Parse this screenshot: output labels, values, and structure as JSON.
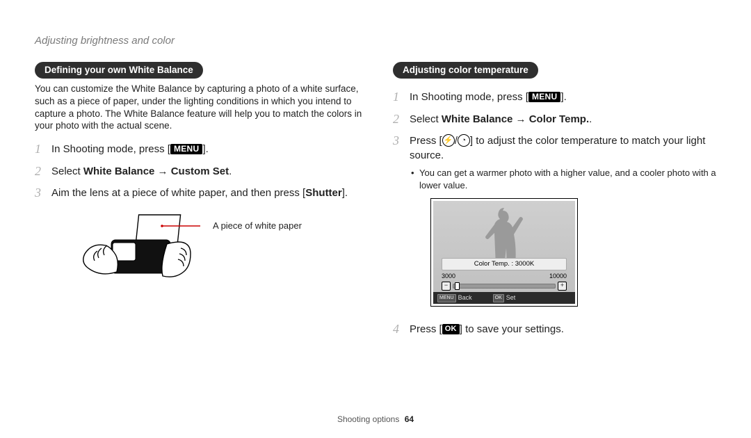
{
  "breadcrumb": "Adjusting brightness and color",
  "left": {
    "pill": "Defining your own White Balance",
    "intro": "You can customize the White Balance by capturing a photo of a white surface, such as a piece of paper, under the lighting conditions in which you intend to capture a photo. The White Balance feature will help you to match the colors in your photo with the actual scene.",
    "steps": {
      "s1_a": "In Shooting mode, press [",
      "menu": "MENU",
      "s1_b": "].",
      "s2_a": "Select ",
      "s2_bold": "White Balance → Custom Set",
      "s2_b": ".",
      "s3_a": "Aim the lens at a piece of white paper, and then press [",
      "s3_bold": "Shutter",
      "s3_b": "]."
    },
    "callout": "A piece of white paper"
  },
  "right": {
    "pill": "Adjusting color temperature",
    "steps": {
      "s1_a": "In Shooting mode, press [",
      "menu": "MENU",
      "s1_b": "].",
      "s2_a": "Select ",
      "s2_bold": "White Balance → Color Temp.",
      "s2_b": ".",
      "s3_a": "Press [",
      "s3_b": "/",
      "s3_c": "] to adjust the color temperature to match your light source.",
      "s3_sub": "You can get a warmer photo with a higher value, and a cooler photo with a lower value.",
      "s4_a": "Press [",
      "ok": "OK",
      "s4_b": "] to save your settings."
    },
    "lcd": {
      "label": "Color Temp. : 3000K",
      "min": "3000",
      "max": "10000",
      "minus": "−",
      "plus": "+",
      "back_chip": "MENU",
      "back": "Back",
      "set_chip": "OK",
      "set": "Set"
    }
  },
  "footer": {
    "section": "Shooting options",
    "page": "64"
  },
  "icons": {
    "flash": "⚡",
    "timer": "◔"
  }
}
